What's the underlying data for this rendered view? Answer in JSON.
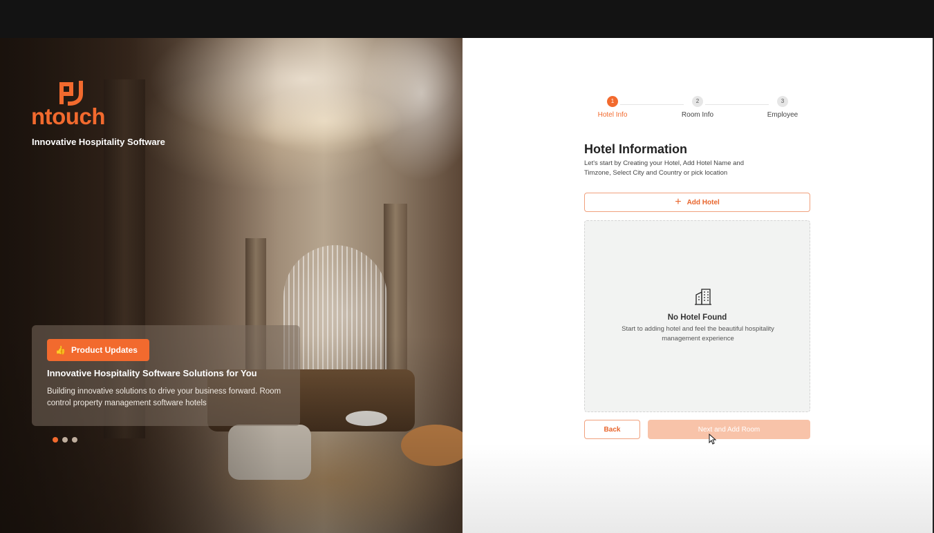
{
  "brand": {
    "name": "ntouch",
    "tagline": "Innovative Hospitality Software",
    "accent_color": "#f26a2e"
  },
  "promo": {
    "badge_icon": "thumbs-up-icon",
    "badge_label": "Product Updates",
    "title": "Innovative Hospitality Software Solutions for You",
    "description": "Building innovative solutions to drive your business forward. Room control  property management software hotels",
    "slides_total": 3,
    "active_slide": 1
  },
  "stepper": {
    "steps": [
      {
        "number": "1",
        "label": "Hotel Info",
        "active": true
      },
      {
        "number": "2",
        "label": "Room Info",
        "active": false
      },
      {
        "number": "3",
        "label": "Employee",
        "active": false
      }
    ]
  },
  "form": {
    "title": "Hotel Information",
    "description": "Let's start by Creating your Hotel, Add Hotel Name and Timzone, Select City and Country or pick location",
    "add_button_label": "Add Hotel",
    "add_button_icon": "plus-icon"
  },
  "empty_state": {
    "icon": "building-icon",
    "title": "No Hotel Found",
    "description": "Start to adding hotel and feel the beautiful hospitality management experience"
  },
  "actions": {
    "back_label": "Back",
    "next_label": "Next and Add Room"
  }
}
